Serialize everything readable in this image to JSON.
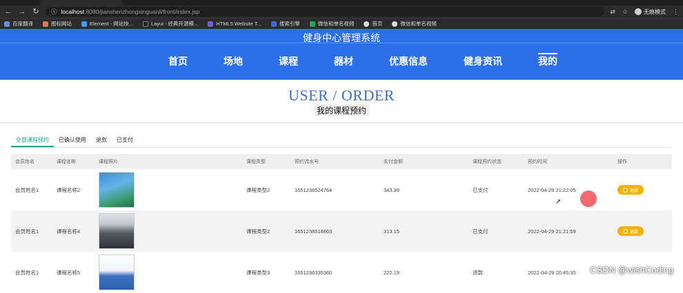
{
  "browser": {
    "url_host": "localhost",
    "url_path": ":8080/jianshenzhongxinguanli/front/index.jsp",
    "profile_label": "无痕模式",
    "bookmarks": [
      "百度翻译",
      "图标网站",
      "Element - 网站快...",
      "Layui - 经典开源模...",
      "HTML5 Website T...",
      "搜索引擎",
      "微信和单名视频",
      "首页",
      "微信和单名视频"
    ]
  },
  "site": {
    "title": "健身中心管理系统",
    "nav": [
      "首页",
      "场地",
      "课程",
      "器材",
      "优惠信息",
      "健身资讯",
      "我的"
    ]
  },
  "heading": {
    "en": "USER / ORDER",
    "cn": "我的课程预约"
  },
  "tabs": [
    "全部课程预约",
    "已确认使用",
    "退款",
    "已支付"
  ],
  "table": {
    "headers": [
      "会员姓名",
      "课程名称",
      "课程照片",
      "课程类型",
      "预约流水号",
      "实付金额",
      "课程预约状态",
      "预约时间",
      "操作"
    ],
    "rows": [
      {
        "member": "会员姓名1",
        "course": "课程名称2",
        "type": "课程类型2",
        "serial": "1651238524764",
        "amount": "343.39",
        "status": "已支付",
        "time": "2022-04-29 21:22:05",
        "action": "退款"
      },
      {
        "member": "会员姓名1",
        "course": "课程名称4",
        "type": "课程类型2",
        "serial": "1651238518803",
        "amount": "313.15",
        "status": "已支付",
        "time": "2022-04-29 21:21:59",
        "action": "退款"
      },
      {
        "member": "会员姓名1",
        "course": "课程名称5",
        "type": "课程类型3",
        "serial": "1651236335360",
        "amount": "222.19",
        "status": "退款",
        "time": "2022-04-29 20:45:35",
        "action": ""
      }
    ]
  },
  "watermark": "CSDN @wishCoding",
  "colors": {
    "header": "#2d6fe8",
    "accent_tab": "#2a9d8f",
    "pay_button": "#f5b301",
    "heading": "#3c6fd1"
  }
}
